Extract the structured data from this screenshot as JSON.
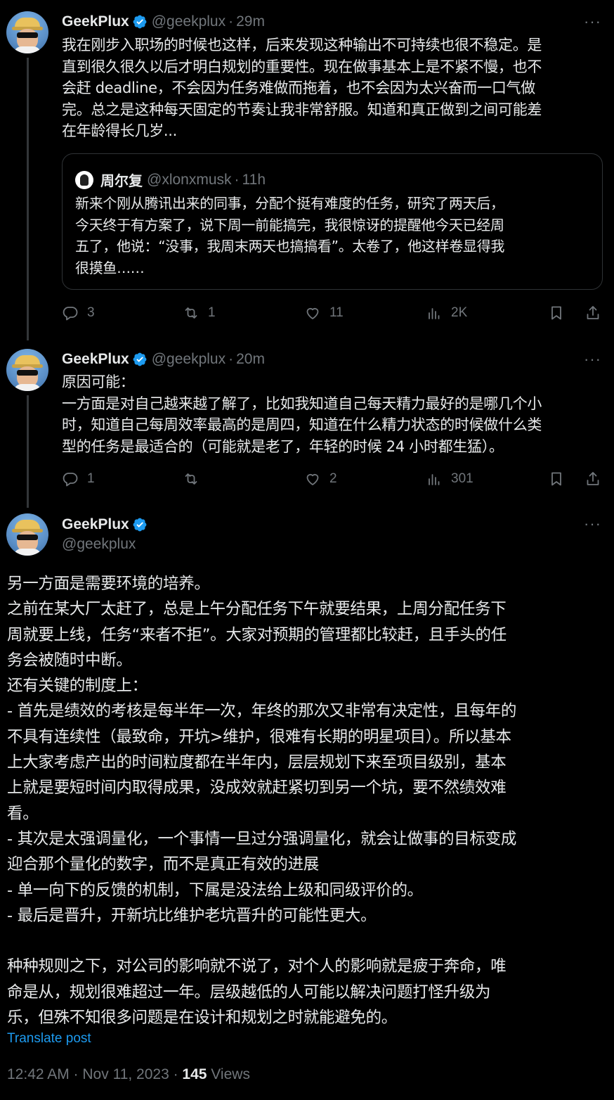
{
  "colors": {
    "background": "#000000",
    "text": "#e7e9ea",
    "muted": "#71767b",
    "accent": "#1d9bf0",
    "border": "#2f3336"
  },
  "tweet1": {
    "name": "GeekPlux",
    "handle": "@geekplux",
    "separator": "·",
    "time": "29m",
    "more": "···",
    "text": "我在刚步入职场的时候也这样，后来发现这种输出不可持续也很不稳定。是\n直到很久很久以后才明白规划的重要性。现在做事基本上是不紧不慢，也不\n会赶 deadline，不会因为任务难做而拖着，也不会因为太兴奋而一口气做\n完。总之是这种每天固定的节奏让我非常舒服。知道和真正做到之间可能差\n在年龄得长几岁...",
    "quote": {
      "name": "周尔复",
      "handle": "@xlonxmusk",
      "separator": "·",
      "time": "11h",
      "text": "新来个刚从腾讯出来的同事，分配个挺有难度的任务，研究了两天后，\n今天终于有方案了，说下周一前能搞完，我很惊讶的提醒他今天已经周\n五了，他说：“没事，我周末两天也搞搞看”。太卷了，他这样卷显得我\n很摸鱼……"
    },
    "replies": "3",
    "reposts": "1",
    "likes": "11",
    "views": "2K"
  },
  "tweet2": {
    "name": "GeekPlux",
    "handle": "@geekplux",
    "separator": "·",
    "time": "20m",
    "more": "···",
    "text": "原因可能：\n一方面是对自己越来越了解了，比如我知道自己每天精力最好的是哪几个小\n时，知道自己每周效率最高的是周四，知道在什么精力状态的时候做什么类\n型的任务是最适合的（可能就是老了，年轻的时候 24 小时都生猛）。",
    "replies": "1",
    "reposts": "",
    "likes": "2",
    "views": "301"
  },
  "tweet3": {
    "name": "GeekPlux",
    "handle": "@geekplux",
    "more": "···",
    "text": "另一方面是需要环境的培养。\n之前在某大厂太赶了，总是上午分配任务下午就要结果，上周分配任务下\n周就要上线，任务“来者不拒”。大家对预期的管理都比较赶，且手头的任\n务会被随时中断。\n还有关键的制度上：\n- 首先是绩效的考核是每半年一次，年终的那次又非常有决定性，且每年的\n不具有连续性（最致命，开坑>维护，很难有长期的明星项目）。所以基本\n上大家考虑产出的时间粒度都在半年内，层层规划下来至项目级别，基本\n上就是要短时间内取得成果，没成效就赶紧切到另一个坑，要不然绩效难\n看。\n- 其次是太强调量化，一个事情一旦过分强调量化，就会让做事的目标变成\n迎合那个量化的数字，而不是真正有效的进展\n- 单一向下的反馈的机制，下属是没法给上级和同级评价的。\n- 最后是晋升，开新坑比维护老坑晋升的可能性更大。\n\n种种规则之下，对公司的影响就不说了，对个人的影响就是疲于奔命，唯\n命是从，规划很难超过一年。层级越低的人可能以解决问题打怪升级为\n乐，但殊不知很多问题是在设计和规划之时就能避免的。",
    "translate": "Translate post",
    "timestamp": "12:42 AM · Nov 11, 2023 · ",
    "views_count": "145",
    "views_label": " Views"
  }
}
